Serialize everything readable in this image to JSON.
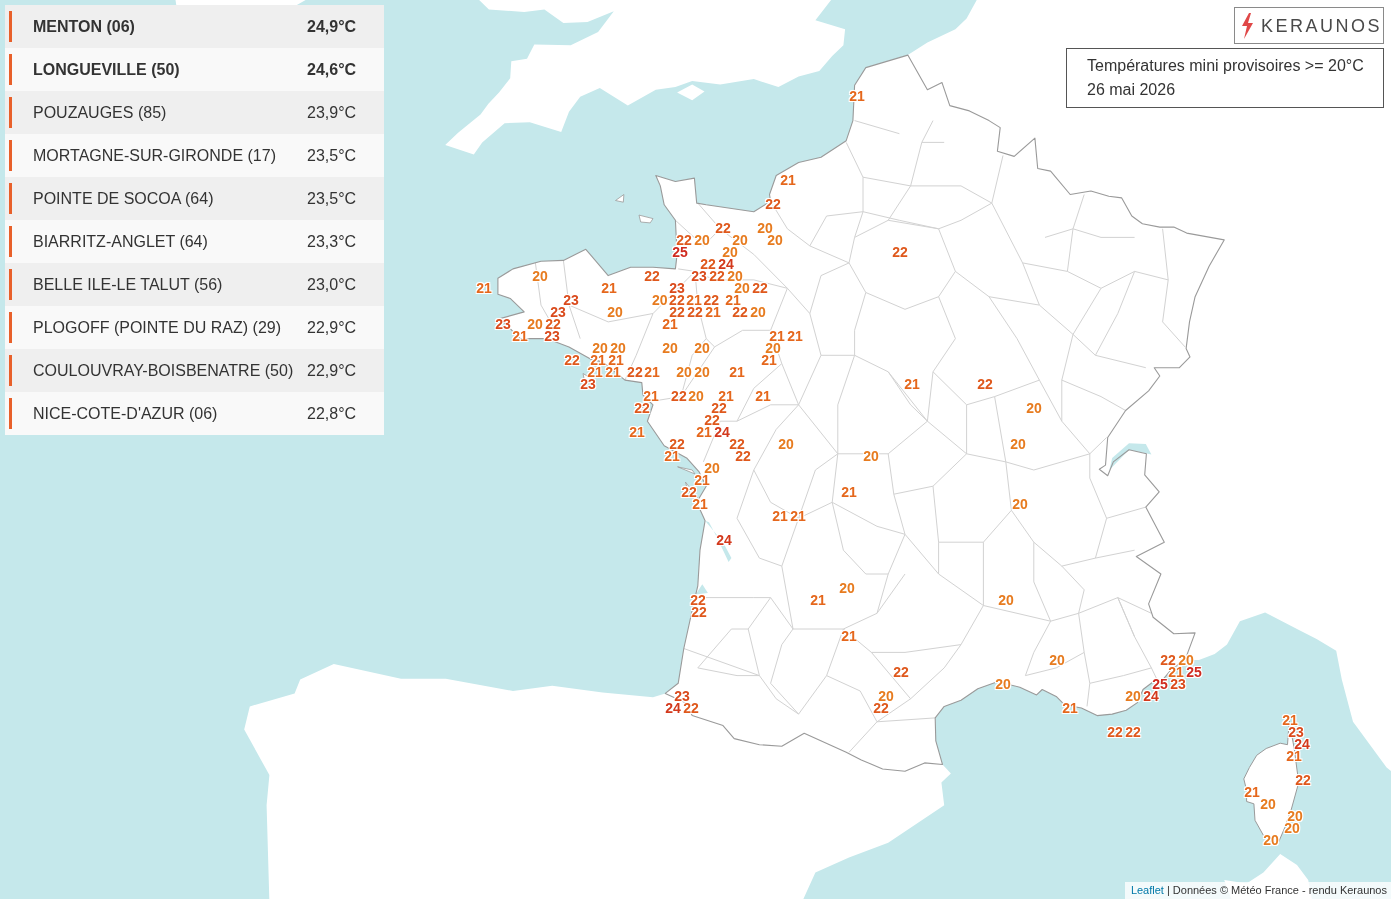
{
  "ranking": [
    {
      "station": "MENTON (06)",
      "temperature": "24,9°C",
      "bold": true
    },
    {
      "station": "LONGUEVILLE (50)",
      "temperature": "24,6°C",
      "bold": true
    },
    {
      "station": "POUZAUGES (85)",
      "temperature": "23,9°C",
      "bold": false
    },
    {
      "station": "MORTAGNE-SUR-GIRONDE (17)",
      "temperature": "23,5°C",
      "bold": false
    },
    {
      "station": "POINTE DE SOCOA (64)",
      "temperature": "23,5°C",
      "bold": false
    },
    {
      "station": "BIARRITZ-ANGLET (64)",
      "temperature": "23,3°C",
      "bold": false
    },
    {
      "station": "BELLE ILE-LE TALUT (56)",
      "temperature": "23,0°C",
      "bold": false
    },
    {
      "station": "PLOGOFF (POINTE DU RAZ) (29)",
      "temperature": "22,9°C",
      "bold": false
    },
    {
      "station": "COULOUVRAY-BOISBENATRE (50)",
      "temperature": "22,9°C",
      "bold": false
    },
    {
      "station": "NICE-COTE-D'AZUR (06)",
      "temperature": "22,8°C",
      "bold": false
    }
  ],
  "logo": {
    "text": "KERAUNOS"
  },
  "legend": {
    "title": "Températures mini provisoires >= 20°C",
    "date": "26 mai 2026"
  },
  "map": {
    "markers": [
      {
        "label": "21",
        "color": "#e5671c"
      },
      {
        "label": "21",
        "color": "#e5671c"
      },
      {
        "label": "22",
        "color": "#df581c"
      },
      {
        "label": "22",
        "color": "#df581c"
      },
      {
        "label": "20",
        "color": "#e77b1f"
      },
      {
        "label": "22",
        "color": "#df581c"
      },
      {
        "label": "20",
        "color": "#e77b1f"
      },
      {
        "label": "20",
        "color": "#e77b1f"
      },
      {
        "label": "20",
        "color": "#e77b1f"
      },
      {
        "label": "25",
        "color": "#cf2a1f"
      },
      {
        "label": "20",
        "color": "#e77b1f"
      },
      {
        "label": "22",
        "color": "#df581c"
      },
      {
        "label": "22",
        "color": "#df581c"
      },
      {
        "label": "24",
        "color": "#d3391c"
      },
      {
        "label": "20",
        "color": "#e77b1f"
      },
      {
        "label": "22",
        "color": "#df581c"
      },
      {
        "label": "23",
        "color": "#da4a1c"
      },
      {
        "label": "22",
        "color": "#df581c"
      },
      {
        "label": "20",
        "color": "#e77b1f"
      },
      {
        "label": "21",
        "color": "#e5671c"
      },
      {
        "label": "21",
        "color": "#e5671c"
      },
      {
        "label": "23",
        "color": "#da4a1c"
      },
      {
        "label": "20",
        "color": "#e77b1f"
      },
      {
        "label": "22",
        "color": "#df581c"
      },
      {
        "label": "23",
        "color": "#da4a1c"
      },
      {
        "label": "20",
        "color": "#e77b1f"
      },
      {
        "label": "22",
        "color": "#df581c"
      },
      {
        "label": "21",
        "color": "#e5671c"
      },
      {
        "label": "22",
        "color": "#df581c"
      },
      {
        "label": "21",
        "color": "#e5671c"
      },
      {
        "label": "23",
        "color": "#da4a1c"
      },
      {
        "label": "20",
        "color": "#e77b1f"
      },
      {
        "label": "22",
        "color": "#df581c"
      },
      {
        "label": "22",
        "color": "#df581c"
      },
      {
        "label": "21",
        "color": "#e5671c"
      },
      {
        "label": "22",
        "color": "#df581c"
      },
      {
        "label": "20",
        "color": "#e77b1f"
      },
      {
        "label": "23",
        "color": "#da4a1c"
      },
      {
        "label": "20",
        "color": "#e77b1f"
      },
      {
        "label": "22",
        "color": "#df581c"
      },
      {
        "label": "21",
        "color": "#e5671c"
      },
      {
        "label": "21",
        "color": "#e5671c"
      },
      {
        "label": "23",
        "color": "#da4a1c"
      },
      {
        "label": "21",
        "color": "#e5671c"
      },
      {
        "label": "21",
        "color": "#e5671c"
      },
      {
        "label": "20",
        "color": "#e77b1f"
      },
      {
        "label": "20",
        "color": "#e77b1f"
      },
      {
        "label": "20",
        "color": "#e77b1f"
      },
      {
        "label": "20",
        "color": "#e77b1f"
      },
      {
        "label": "20",
        "color": "#e77b1f"
      },
      {
        "label": "22",
        "color": "#df581c"
      },
      {
        "label": "21",
        "color": "#e5671c"
      },
      {
        "label": "21",
        "color": "#e5671c"
      },
      {
        "label": "21",
        "color": "#e5671c"
      },
      {
        "label": "21",
        "color": "#e5671c"
      },
      {
        "label": "21",
        "color": "#e5671c"
      },
      {
        "label": "22",
        "color": "#df581c"
      },
      {
        "label": "21",
        "color": "#e5671c"
      },
      {
        "label": "20",
        "color": "#e77b1f"
      },
      {
        "label": "20",
        "color": "#e77b1f"
      },
      {
        "label": "21",
        "color": "#e5671c"
      },
      {
        "label": "23",
        "color": "#da4a1c"
      },
      {
        "label": "21",
        "color": "#e5671c"
      },
      {
        "label": "22",
        "color": "#df581c"
      },
      {
        "label": "21",
        "color": "#e5671c"
      },
      {
        "label": "22",
        "color": "#df581c"
      },
      {
        "label": "20",
        "color": "#e77b1f"
      },
      {
        "label": "21",
        "color": "#e5671c"
      },
      {
        "label": "21",
        "color": "#e5671c"
      },
      {
        "label": "22",
        "color": "#df581c"
      },
      {
        "label": "22",
        "color": "#df581c"
      },
      {
        "label": "20",
        "color": "#e77b1f"
      },
      {
        "label": "22",
        "color": "#df581c"
      },
      {
        "label": "21",
        "color": "#e5671c"
      },
      {
        "label": "21",
        "color": "#e5671c"
      },
      {
        "label": "24",
        "color": "#d3391c"
      },
      {
        "label": "22",
        "color": "#df581c"
      },
      {
        "label": "22",
        "color": "#df581c"
      },
      {
        "label": "20",
        "color": "#e77b1f"
      },
      {
        "label": "20",
        "color": "#e77b1f"
      },
      {
        "label": "21",
        "color": "#e5671c"
      },
      {
        "label": "22",
        "color": "#df581c"
      },
      {
        "label": "20",
        "color": "#e77b1f"
      },
      {
        "label": "20",
        "color": "#e77b1f"
      },
      {
        "label": "21",
        "color": "#e5671c"
      },
      {
        "label": "22",
        "color": "#df581c"
      },
      {
        "label": "21",
        "color": "#e5671c"
      },
      {
        "label": "21",
        "color": "#e5671c"
      },
      {
        "label": "20",
        "color": "#e77b1f"
      },
      {
        "label": "21",
        "color": "#e5671c"
      },
      {
        "label": "21",
        "color": "#e5671c"
      },
      {
        "label": "24",
        "color": "#d3391c"
      },
      {
        "label": "20",
        "color": "#e77b1f"
      },
      {
        "label": "22",
        "color": "#df581c"
      },
      {
        "label": "21",
        "color": "#e5671c"
      },
      {
        "label": "20",
        "color": "#e77b1f"
      },
      {
        "label": "22",
        "color": "#df581c"
      },
      {
        "label": "21",
        "color": "#e5671c"
      },
      {
        "label": "20",
        "color": "#e77b1f"
      },
      {
        "label": "22",
        "color": "#df581c"
      },
      {
        "label": "20",
        "color": "#e77b1f"
      },
      {
        "label": "22",
        "color": "#df581c"
      },
      {
        "label": "21",
        "color": "#e5671c"
      },
      {
        "label": "25",
        "color": "#cf2a1f"
      },
      {
        "label": "20",
        "color": "#e77b1f"
      },
      {
        "label": "25",
        "color": "#cf2a1f"
      },
      {
        "label": "23",
        "color": "#da4a1c"
      },
      {
        "label": "23",
        "color": "#da4a1c"
      },
      {
        "label": "20",
        "color": "#e77b1f"
      },
      {
        "label": "20",
        "color": "#e77b1f"
      },
      {
        "label": "24",
        "color": "#d3391c"
      },
      {
        "label": "24",
        "color": "#d3391c"
      },
      {
        "label": "22",
        "color": "#df581c"
      },
      {
        "label": "22",
        "color": "#df581c"
      },
      {
        "label": "21",
        "color": "#e5671c"
      },
      {
        "label": "21",
        "color": "#e5671c"
      },
      {
        "label": "22",
        "color": "#df581c"
      },
      {
        "label": "22",
        "color": "#df581c"
      },
      {
        "label": "23",
        "color": "#da4a1c"
      },
      {
        "label": "24",
        "color": "#d3391c"
      },
      {
        "label": "21",
        "color": "#e5671c"
      },
      {
        "label": "22",
        "color": "#df581c"
      },
      {
        "label": "21",
        "color": "#e5671c"
      },
      {
        "label": "20",
        "color": "#e77b1f"
      },
      {
        "label": "20",
        "color": "#e77b1f"
      },
      {
        "label": "20",
        "color": "#e77b1f"
      },
      {
        "label": "20",
        "color": "#e77b1f"
      }
    ]
  },
  "attribution": {
    "link": "Leaflet",
    "text": "| Données © Météo France - rendu Keraunos"
  }
}
